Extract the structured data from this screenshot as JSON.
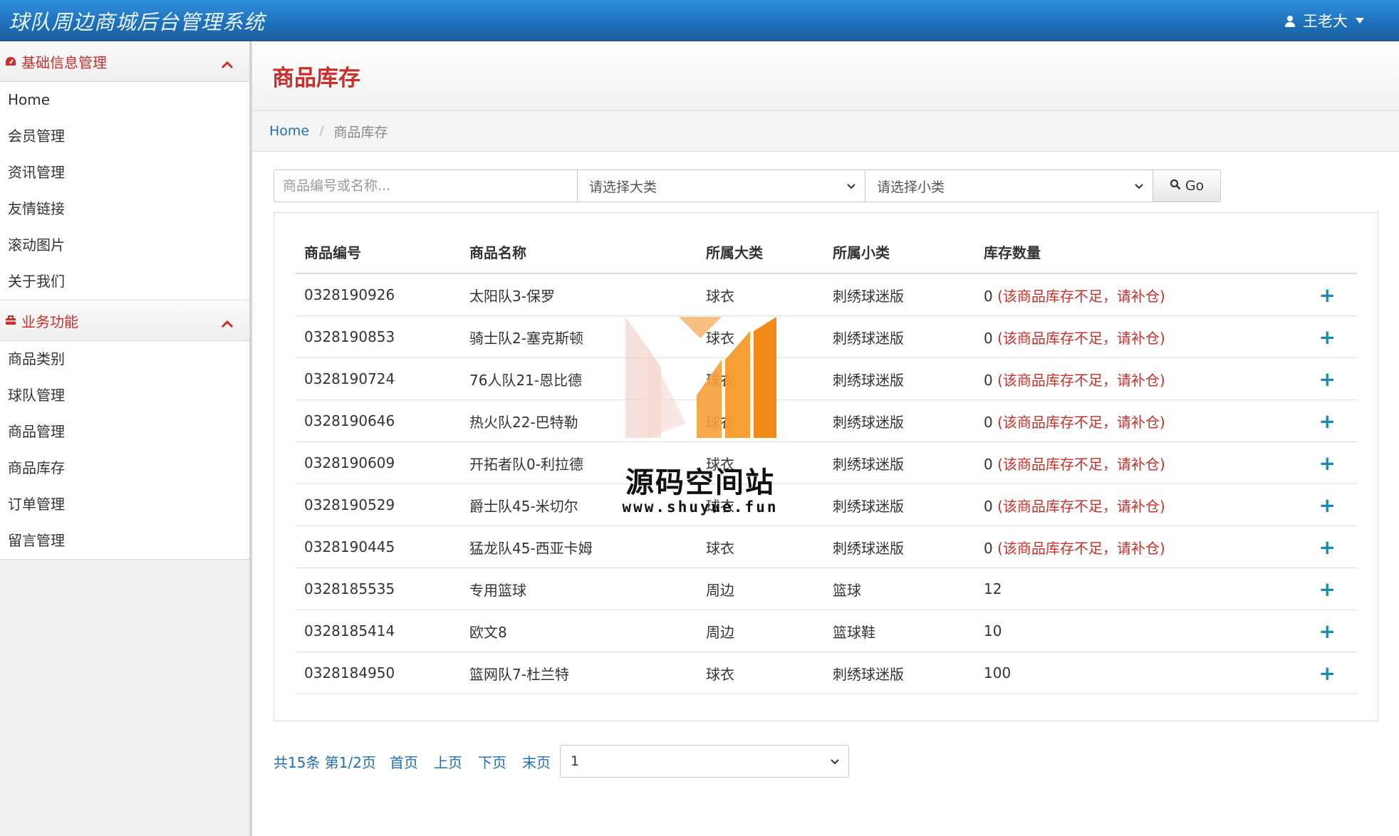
{
  "app": {
    "title": "球队周边商城后台管理系统"
  },
  "user": {
    "name": "王老大",
    "icon": "user-icon"
  },
  "colors": {
    "accent_red": "#c9302c",
    "link_blue": "#1f6fb5",
    "header_blue": "#1e6fb8"
  },
  "sidebar": {
    "groups": [
      {
        "title": "基础信息管理",
        "icon": "dashboard-icon",
        "items": [
          "Home",
          "会员管理",
          "资讯管理",
          "友情链接",
          "滚动图片",
          "关于我们"
        ]
      },
      {
        "title": "业务功能",
        "icon": "briefcase-icon",
        "items": [
          "商品类别",
          "球队管理",
          "商品管理",
          "商品库存",
          "订单管理",
          "留言管理"
        ]
      }
    ]
  },
  "page": {
    "title": "商品库存"
  },
  "breadcrumb": {
    "home": "Home",
    "separator": "/",
    "current": "商品库存"
  },
  "filters": {
    "search_placeholder": "商品编号或名称...",
    "category_select": "请选择大类",
    "subcategory_select": "请选择小类",
    "go_label": "Go"
  },
  "table": {
    "columns": [
      "商品编号",
      "商品名称",
      "所属大类",
      "所属小类",
      "库存数量"
    ],
    "rows": [
      {
        "id": "0328190926",
        "name": "太阳队3-保罗",
        "cat": "球衣",
        "sub": "刺绣球迷版",
        "qty": "0",
        "warn": "(该商品库存不足，请补仓)"
      },
      {
        "id": "0328190853",
        "name": "骑士队2-塞克斯顿",
        "cat": "球衣",
        "sub": "刺绣球迷版",
        "qty": "0",
        "warn": "(该商品库存不足，请补仓)"
      },
      {
        "id": "0328190724",
        "name": "76人队21-恩比德",
        "cat": "球衣",
        "sub": "刺绣球迷版",
        "qty": "0",
        "warn": "(该商品库存不足，请补仓)"
      },
      {
        "id": "0328190646",
        "name": "热火队22-巴特勒",
        "cat": "球衣",
        "sub": "刺绣球迷版",
        "qty": "0",
        "warn": "(该商品库存不足，请补仓)"
      },
      {
        "id": "0328190609",
        "name": "开拓者队0-利拉德",
        "cat": "球衣",
        "sub": "刺绣球迷版",
        "qty": "0",
        "warn": "(该商品库存不足，请补仓)"
      },
      {
        "id": "0328190529",
        "name": "爵士队45-米切尔",
        "cat": "球衣",
        "sub": "刺绣球迷版",
        "qty": "0",
        "warn": "(该商品库存不足，请补仓)"
      },
      {
        "id": "0328190445",
        "name": "猛龙队45-西亚卡姆",
        "cat": "球衣",
        "sub": "刺绣球迷版",
        "qty": "0",
        "warn": "(该商品库存不足，请补仓)"
      },
      {
        "id": "0328185535",
        "name": "专用篮球",
        "cat": "周边",
        "sub": "篮球",
        "qty": "12",
        "warn": ""
      },
      {
        "id": "0328185414",
        "name": "欧文8",
        "cat": "周边",
        "sub": "篮球鞋",
        "qty": "10",
        "warn": ""
      },
      {
        "id": "0328184950",
        "name": "篮网队7-杜兰特",
        "cat": "球衣",
        "sub": "刺绣球迷版",
        "qty": "100",
        "warn": ""
      }
    ],
    "action_label": "+"
  },
  "pager": {
    "info": "共15条 第1/2页",
    "first": "首页",
    "prev": "上页",
    "next": "下页",
    "last": "末页",
    "page_select": "1"
  },
  "watermark": {
    "title": "源码空间站",
    "url": "www.shuyue.fun"
  }
}
